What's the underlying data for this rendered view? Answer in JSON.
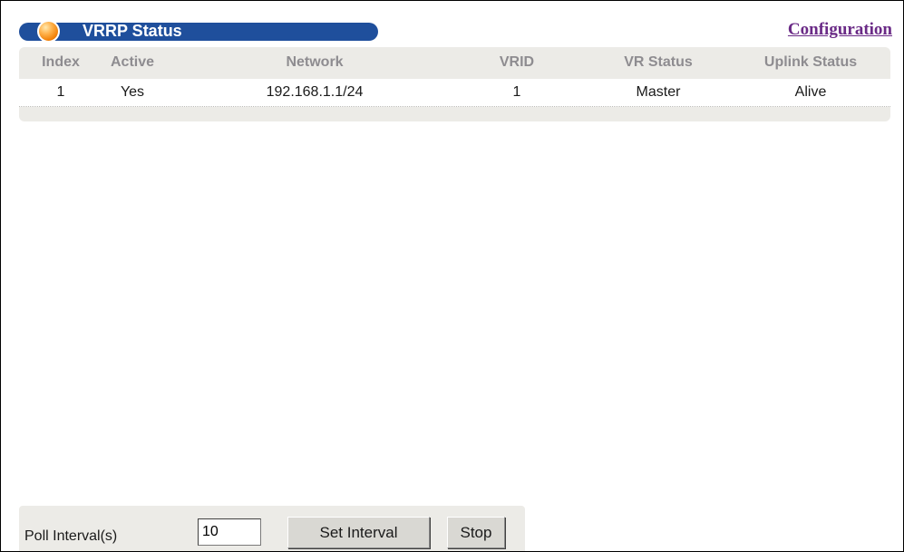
{
  "header": {
    "title": "VRRP Status",
    "config_link": "Configuration"
  },
  "table": {
    "columns": [
      "Index",
      "Active",
      "Network",
      "VRID",
      "VR Status",
      "Uplink Status"
    ],
    "rows": [
      [
        "1",
        "Yes",
        "192.168.1.1/24",
        "1",
        "Master",
        "Alive"
      ]
    ]
  },
  "poll": {
    "label": "Poll Interval(s)",
    "value": "10",
    "set_button": "Set Interval",
    "stop_button": "Stop"
  },
  "colors": {
    "title_bar": "#1f4f9c",
    "link": "#6a2a86",
    "panel": "#ecebe7"
  }
}
